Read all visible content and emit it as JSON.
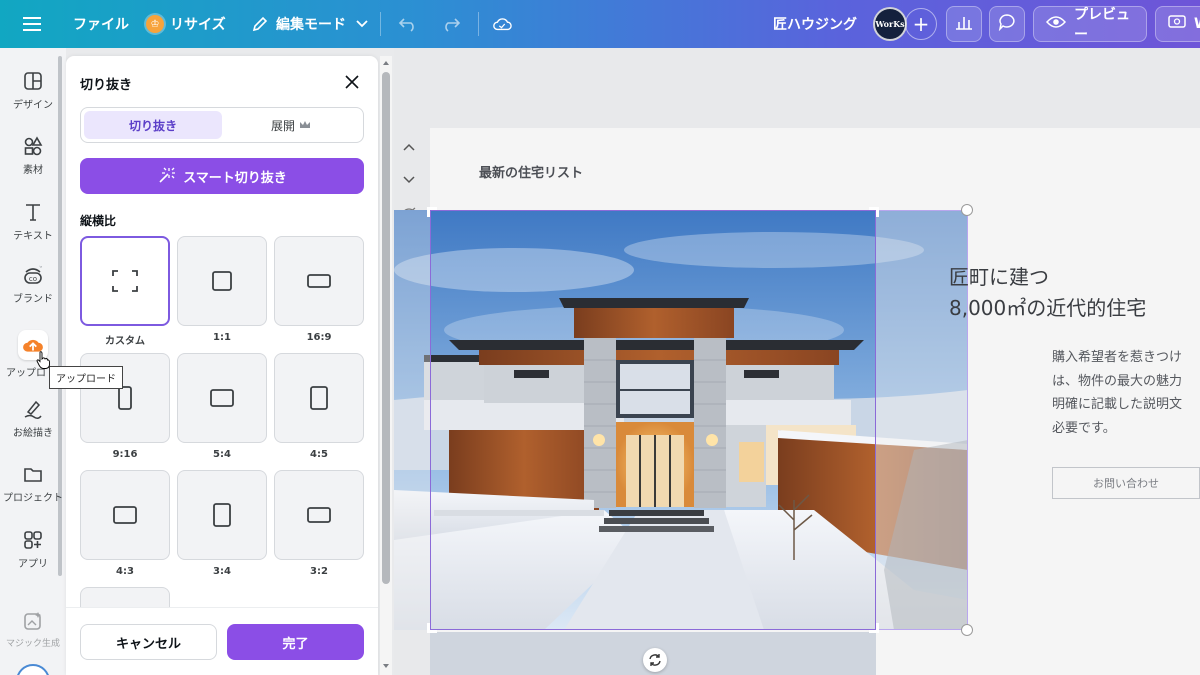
{
  "topbar": {
    "file_label": "ファイル",
    "resize_label": "リサイズ",
    "edit_mode_label": "編集モード",
    "doc_title": "匠ハウジング",
    "avatar_text": "WorKs",
    "preview_label": "プレビュー",
    "cut_label": "W"
  },
  "rail": {
    "items": [
      {
        "label": "デザイン",
        "icon": "layout-icon"
      },
      {
        "label": "素材",
        "icon": "elements-icon"
      },
      {
        "label": "テキスト",
        "icon": "text-icon"
      },
      {
        "label": "ブランド",
        "icon": "brand-icon"
      },
      {
        "label": "アップロ",
        "icon": "upload-icon"
      },
      {
        "label": "お絵描き",
        "icon": "draw-icon"
      },
      {
        "label": "プロジェクト",
        "icon": "folder-icon"
      },
      {
        "label": "アプリ",
        "icon": "apps-icon"
      },
      {
        "label": "マジック生成",
        "icon": "magic-icon"
      }
    ],
    "tooltip": "アップロード"
  },
  "crop_panel": {
    "title": "切り抜き",
    "tabs": [
      {
        "label": "切り抜き",
        "active": true
      },
      {
        "label": "展開",
        "active": false
      }
    ],
    "smart_crop_label": "スマート切り抜き",
    "ratio_heading": "縦横比",
    "ratios": [
      {
        "label": "カスタム",
        "selected": true
      },
      {
        "label": "1:1"
      },
      {
        "label": "16:9"
      },
      {
        "label": "9:16"
      },
      {
        "label": "5:4"
      },
      {
        "label": "4:5"
      },
      {
        "label": "4:3"
      },
      {
        "label": "3:4"
      },
      {
        "label": "3:2"
      }
    ],
    "cancel_label": "キャンセル",
    "done_label": "完了"
  },
  "canvas": {
    "section_title": "最新の住宅リスト",
    "headline_line1": "匠町に建つ",
    "headline_line2": "8,000㎡の近代的住宅",
    "body_text": "購入希望者を惹きつけ\nは、物件の最大の魅力\n明確に記載した説明文\n必要です。",
    "contact_label": "お問い合わせ"
  },
  "colors": {
    "accent": "#8b4ee6",
    "crop_border": "#8b6ad8"
  }
}
